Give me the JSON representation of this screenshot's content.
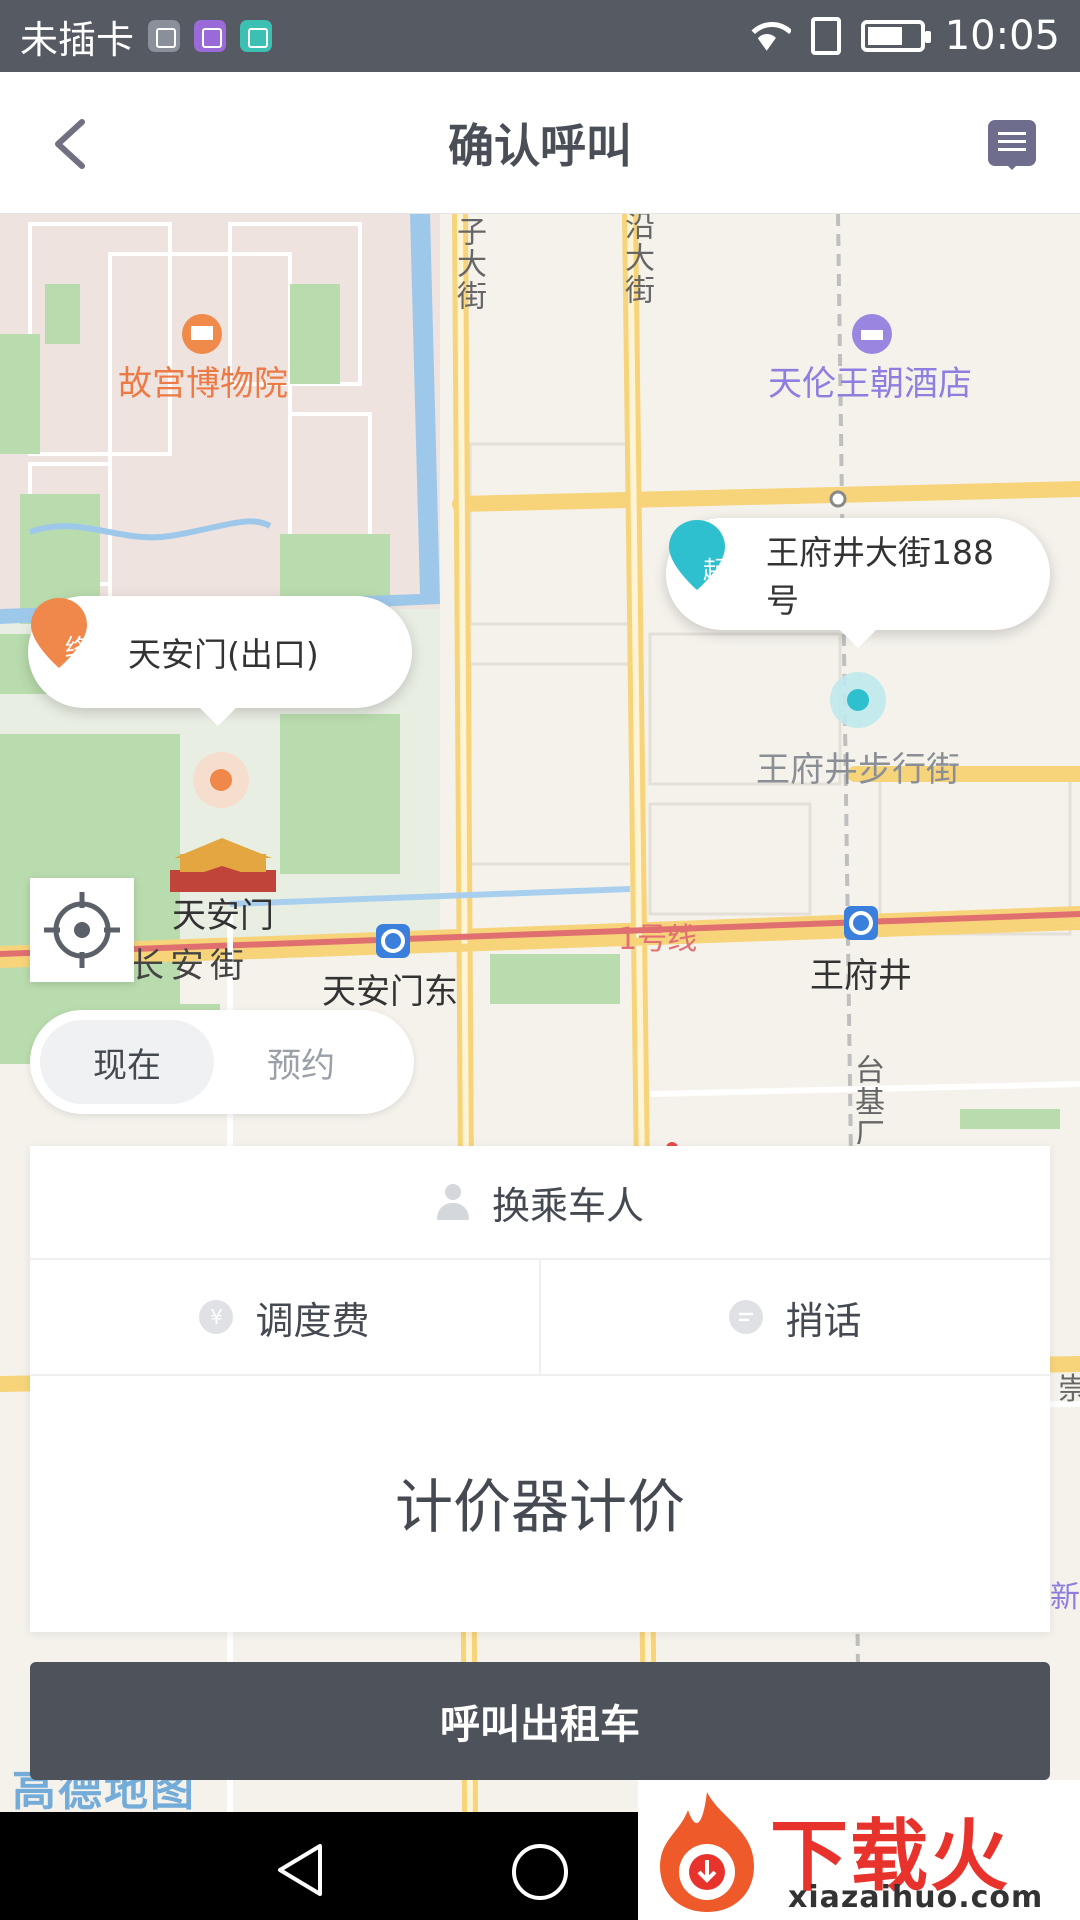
{
  "status_bar": {
    "carrier": "未插卡",
    "time": "10:05"
  },
  "header": {
    "title": "确认呼叫"
  },
  "map": {
    "labels": {
      "palace_museum": "故宫博物院",
      "hotel": "天伦王朝酒店",
      "wangfujing_walk": "王府井步行街",
      "tiananmen": "天安门",
      "changan_street": "长安街",
      "tiananmen_east": "天安门东",
      "line1": "1号线",
      "wangfujing": "王府井",
      "road_zi": "子大街",
      "road_yan": "沿大街",
      "road_tai": "台基厂",
      "edge_chong": "崇",
      "edge_xin": "新"
    },
    "start_marker": {
      "badge": "起",
      "address": "王府井大街188号"
    },
    "end_marker": {
      "badge": "终",
      "address": "天安门(出口)"
    },
    "logo": "高德地图"
  },
  "mode_toggle": {
    "now": "现在",
    "reserve": "预约",
    "selected": "now"
  },
  "panel": {
    "change_passenger": "换乘车人",
    "dispatch_fee": "调度费",
    "dispatch_fee_icon_text": "¥",
    "message": "捎话",
    "fare_text": "计价器计价"
  },
  "call_button": "呼叫出租车",
  "watermark": {
    "brand": "下载火",
    "url": "xiazaihuo.com"
  },
  "colors": {
    "start_pin": "#2fc0cf",
    "end_pin": "#f0874b",
    "primary_button": "#4d525b",
    "status_bar": "#555a63"
  }
}
